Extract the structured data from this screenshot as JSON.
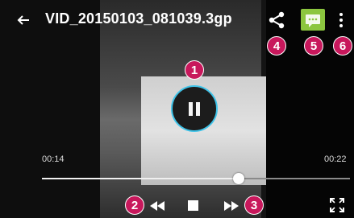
{
  "header": {
    "title": "VID_20150103_081039.3gp",
    "back_icon": "arrow-left-icon",
    "share_icon": "share-icon",
    "message_icon": "message-icon",
    "more_icon": "more-vert-icon"
  },
  "callouts": [
    "1",
    "2",
    "3",
    "4",
    "5",
    "6"
  ],
  "playback": {
    "elapsed": "00:14",
    "duration": "00:22",
    "progress_fraction": 0.64
  },
  "controls": {
    "center": "pause-icon",
    "rewind": "rewind-icon",
    "stop": "stop-icon",
    "fast_forward": "fast-forward-icon",
    "fullscreen": "fullscreen-icon"
  },
  "colors": {
    "callout": "#c8185c",
    "pause_ring": "#3fc3e8",
    "message_bubble": "#8cc63f"
  }
}
